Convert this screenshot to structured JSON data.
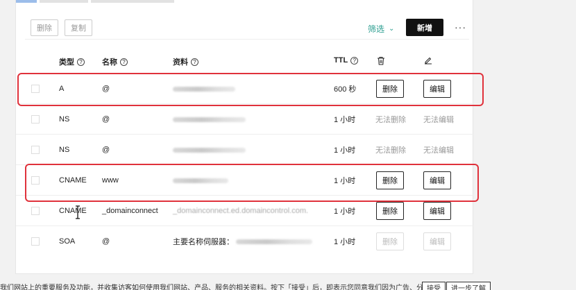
{
  "toolbar": {
    "delete_label": "删除",
    "copy_label": "复制",
    "filter_label": "筛选",
    "add_label": "新增",
    "more_label": "···"
  },
  "table": {
    "headers": {
      "type": "类型",
      "name": "名称",
      "data": "资料",
      "ttl": "TTL"
    },
    "rows": [
      {
        "type": "A",
        "name": "@",
        "data_prefix": "",
        "ttl": "600 秒",
        "delete": "删除",
        "edit": "编辑",
        "actions_enabled": true
      },
      {
        "type": "NS",
        "name": "@",
        "data_prefix": "",
        "ttl": "1 小时",
        "delete": "无法删除",
        "edit": "无法编辑",
        "actions_enabled": false
      },
      {
        "type": "NS",
        "name": "@",
        "data_prefix": "",
        "ttl": "1 小时",
        "delete": "无法删除",
        "edit": "无法编辑",
        "actions_enabled": false
      },
      {
        "type": "CNAME",
        "name": "www",
        "data_prefix": "",
        "ttl": "1 小时",
        "delete": "删除",
        "edit": "编辑",
        "actions_enabled": true
      },
      {
        "type": "CNAME",
        "name": "_domainconnect",
        "data_prefix": "_domainconnect.ed.domaincontrol.com.",
        "ttl": "1 小时",
        "delete": "删除",
        "edit": "编辑",
        "actions_enabled": true
      },
      {
        "type": "SOA",
        "name": "@",
        "data_prefix": "主要名称伺服器：",
        "ttl": "1 小时",
        "delete": "删除",
        "edit": "编辑",
        "actions_enabled": false
      }
    ]
  },
  "footer": {
    "text": "我们网站上的重要服务及功能，并收集访客如何使用我们网站、产品、服务的相关资料。按下「接受」后，即表示您同意我们因为广告、分析及支",
    "accept_label": "接受",
    "learn_more_label": "进一步了解"
  },
  "colors": {
    "highlight": "#e0313b",
    "filter": "#2a9d8f",
    "primary": "#111111"
  }
}
